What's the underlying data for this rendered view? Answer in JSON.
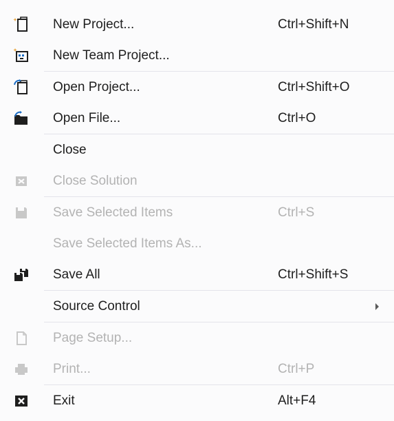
{
  "menu": {
    "items": [
      {
        "label": "New Project...",
        "shortcut": "Ctrl+Shift+N",
        "icon": "new-project-icon"
      },
      {
        "label": "New Team Project...",
        "shortcut": "",
        "icon": "new-team-project-icon"
      },
      {
        "label": "Open Project...",
        "shortcut": "Ctrl+Shift+O",
        "icon": "open-project-icon"
      },
      {
        "label": "Open File...",
        "shortcut": "Ctrl+O",
        "icon": "open-file-icon"
      },
      {
        "label": "Close",
        "shortcut": "",
        "icon": ""
      },
      {
        "label": "Close Solution",
        "shortcut": "",
        "icon": "close-solution-icon",
        "disabled": true
      },
      {
        "label": "Save Selected Items",
        "shortcut": "Ctrl+S",
        "icon": "save-icon",
        "disabled": true
      },
      {
        "label": "Save Selected Items As...",
        "shortcut": "",
        "icon": "",
        "disabled": true
      },
      {
        "label": "Save All",
        "shortcut": "Ctrl+Shift+S",
        "icon": "save-all-icon"
      },
      {
        "label": "Source Control",
        "shortcut": "",
        "icon": "",
        "submenu": true
      },
      {
        "label": "Page Setup...",
        "shortcut": "",
        "icon": "page-setup-icon",
        "disabled": true
      },
      {
        "label": "Print...",
        "shortcut": "Ctrl+P",
        "icon": "print-icon",
        "disabled": true
      },
      {
        "label": "Exit",
        "shortcut": "Alt+F4",
        "icon": "exit-icon"
      }
    ]
  },
  "colors": {
    "background": "#fbfbfc",
    "text": "#1e1e1e",
    "disabled_text": "#b3b3b3",
    "separator": "#e3e3ea",
    "icon_dark": "#1e1e1e",
    "icon_blue": "#1e6fc7",
    "icon_orange": "#e8a33d"
  }
}
